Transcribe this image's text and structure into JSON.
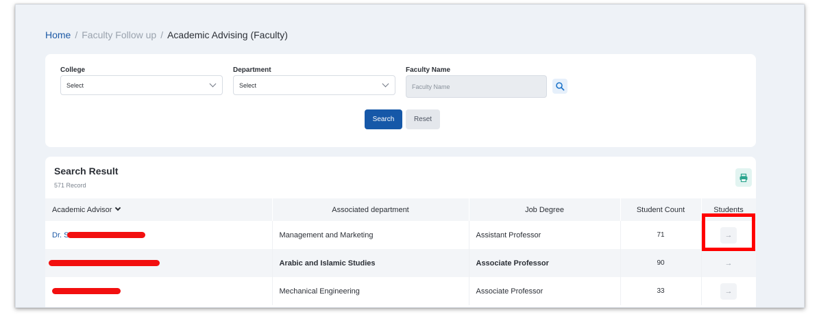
{
  "breadcrumb": {
    "home": "Home",
    "separator": "/",
    "middle": "Faculty Follow up",
    "current": "Academic Advising (Faculty)"
  },
  "filters": {
    "college": {
      "label": "College",
      "value": "Select"
    },
    "department": {
      "label": "Department",
      "value": "Select"
    },
    "faculty_name": {
      "label": "Faculty Name",
      "placeholder": "Faculty Name"
    },
    "search_label": "Search",
    "reset_label": "Reset"
  },
  "results": {
    "title": "Search Result",
    "count": "571 Record",
    "columns": [
      "Academic Advisor",
      "Associated department",
      "Job Degree",
      "Student Count",
      "Students"
    ],
    "rows": [
      {
        "advisor_prefix": "Dr. S",
        "department": "Management and Marketing",
        "job_degree": "Assistant Professor",
        "student_count": "71",
        "students_icon": "→"
      },
      {
        "advisor_prefix": "",
        "department": "Arabic and Islamic Studies",
        "job_degree": "Associate Professor",
        "student_count": "90",
        "students_icon": "→"
      },
      {
        "advisor_prefix": "",
        "department": "Mechanical Engineering",
        "job_degree": "Associate Professor",
        "student_count": "33",
        "students_icon": "→"
      }
    ]
  },
  "colors": {
    "primary": "#1658a8",
    "link": "#1d5aa6",
    "highlight": "#ff0000",
    "redaction": "#f20f0f"
  },
  "icons": {
    "search": "magnifier-icon",
    "print": "printer-icon",
    "row_action": "arrow-right-icon",
    "select": "chevron-down-icon",
    "sort": "chevron-down-icon"
  }
}
